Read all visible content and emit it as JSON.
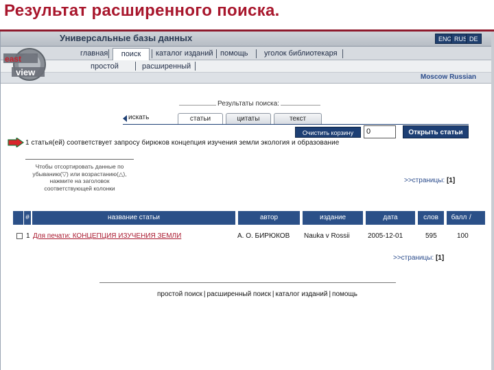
{
  "slide_title": "Результат расширенного поиска.",
  "header": {
    "title": "Универсальные базы данных",
    "languages": [
      "ENG",
      "RUS",
      "DE"
    ]
  },
  "nav": {
    "items": [
      "главная",
      "поиск",
      "каталог изданий",
      "помощь",
      "уголок библиотекаря"
    ],
    "active": "поиск"
  },
  "subnav": {
    "items": [
      "простой",
      "расширенный"
    ]
  },
  "location": "Moscow Russian",
  "logo_text": [
    "east",
    "view"
  ],
  "results": {
    "caption": "Результаты поиска:",
    "back_label": "искать",
    "tabs": [
      "статьи",
      "цитаты",
      "текст"
    ],
    "active_tab": "статьи",
    "clear_button": "Очистить корзину",
    "basket_count": "0",
    "open_button": "Открыть статьи",
    "match_text": "1 статья(ей) соответствует запросу бирюков концепция изучения земли экология и образование",
    "sort_hint": "Чтобы отсортировать данные по убыванию(▽) или возрастанию(△), нажмите на заголовок соответствующей колонки",
    "pages_label": ">>страницы:",
    "pages_value": "[1]"
  },
  "table": {
    "hash": "#",
    "columns": [
      "название статьи",
      "автор",
      "издание",
      "дата",
      "слов",
      "балл"
    ],
    "sort_indicator": "/",
    "rows": [
      {
        "num": "1",
        "title": "Для печати: КОНЦЕПЦИЯ ИЗУЧЕНИЯ ЗЕМЛИ",
        "author": "А. О. БИРЮКОВ",
        "edition": "Nauka v Rossii",
        "date": "2005-12-01",
        "words": "595",
        "score": "100"
      }
    ]
  },
  "footer": {
    "links": [
      "простой поиск",
      "расширенный поиск",
      "каталог изданий",
      "помощь"
    ]
  },
  "colors": {
    "title_red": "#a8162c",
    "navy": "#1d3f74",
    "table_header": "#2b5088",
    "arrow_red": "#d8262c",
    "arrow_green": "#1a7a3a"
  }
}
